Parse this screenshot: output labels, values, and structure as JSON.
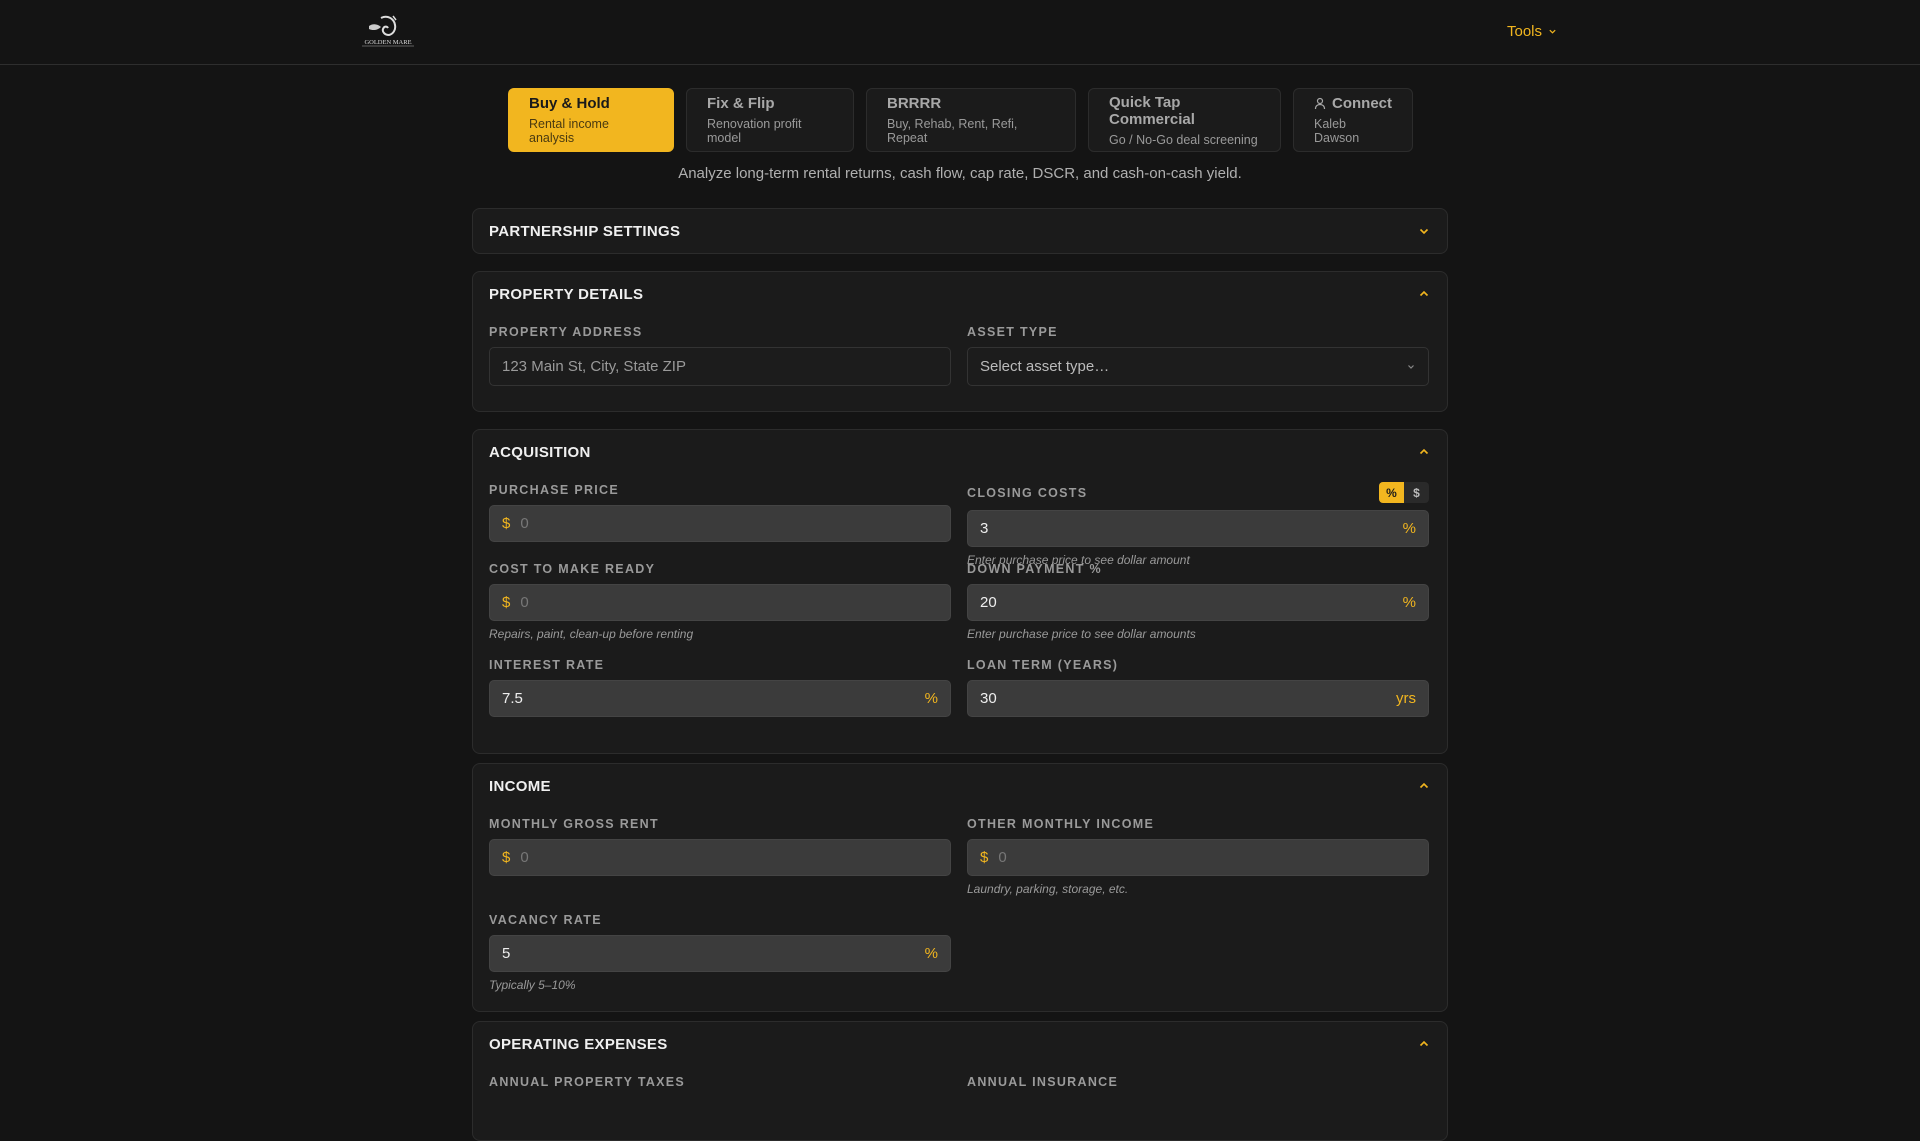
{
  "header": {
    "logo_text": "GOLDEN MARE",
    "tools_label": "Tools"
  },
  "tabs": [
    {
      "title": "Buy & Hold",
      "subtitle": "Rental income analysis",
      "active": true
    },
    {
      "title": "Fix & Flip",
      "subtitle": "Renovation profit model"
    },
    {
      "title": "BRRRR",
      "subtitle": "Buy, Rehab, Rent, Refi, Repeat"
    },
    {
      "title": "Quick Tap Commercial",
      "subtitle": "Go / No-Go deal screening"
    },
    {
      "title": "Connect",
      "subtitle": "Kaleb Dawson"
    }
  ],
  "subtitle": "Analyze long-term rental returns, cash flow, cap rate, DSCR, and cash-on-cash yield.",
  "sections": {
    "partnership": {
      "title": "PARTNERSHIP SETTINGS"
    },
    "property": {
      "title": "PROPERTY DETAILS",
      "address_label": "PROPERTY ADDRESS",
      "address_placeholder": "123 Main St, City, State ZIP",
      "asset_label": "ASSET TYPE",
      "asset_placeholder": "Select asset type…"
    },
    "acquisition": {
      "title": "ACQUISITION",
      "purchase_label": "PURCHASE PRICE",
      "purchase_prefix": "$",
      "purchase_placeholder": "0",
      "closing_label": "CLOSING COSTS",
      "closing_toggle_pct": "%",
      "closing_toggle_usd": "$",
      "closing_value": "3",
      "closing_suffix": "%",
      "closing_hint": "Enter purchase price to see dollar amount",
      "make_ready_label": "COST TO MAKE READY",
      "make_ready_prefix": "$",
      "make_ready_placeholder": "0",
      "make_ready_hint": "Repairs, paint, clean-up before renting",
      "down_label": "DOWN PAYMENT %",
      "down_value": "20",
      "down_suffix": "%",
      "down_hint": "Enter purchase price to see dollar amounts",
      "rate_label": "INTEREST RATE",
      "rate_value": "7.5",
      "rate_suffix": "%",
      "term_label": "LOAN TERM (YEARS)",
      "term_value": "30",
      "term_suffix": "yrs"
    },
    "income": {
      "title": "INCOME",
      "rent_label": "MONTHLY GROSS RENT",
      "rent_prefix": "$",
      "rent_placeholder": "0",
      "other_label": "OTHER MONTHLY INCOME",
      "other_prefix": "$",
      "other_placeholder": "0",
      "other_hint": "Laundry, parking, storage, etc.",
      "vacancy_label": "VACANCY RATE",
      "vacancy_value": "5",
      "vacancy_suffix": "%",
      "vacancy_hint": "Typically 5–10%"
    },
    "operating": {
      "title": "OPERATING EXPENSES",
      "taxes_label": "ANNUAL PROPERTY TAXES",
      "insurance_label": "ANNUAL INSURANCE"
    }
  },
  "colors": {
    "accent": "#f2b61f",
    "background": "#141414",
    "card": "#1b1b1b"
  }
}
